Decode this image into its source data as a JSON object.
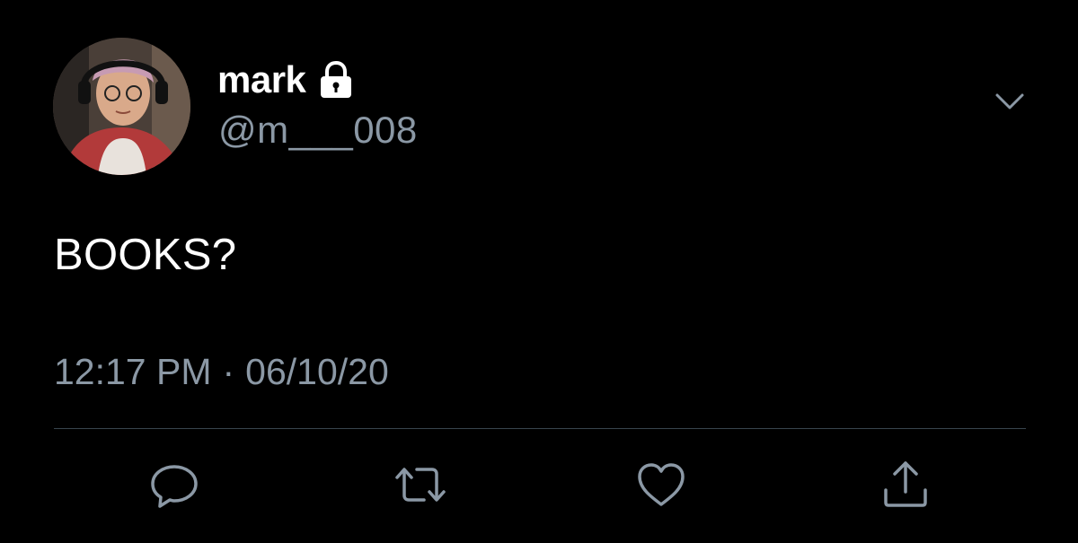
{
  "tweet": {
    "display_name": "mark",
    "handle": "@m___008",
    "text": "BOOKS?",
    "time": "12:17 PM",
    "separator": "·",
    "date": "06/10/20",
    "protected": true
  },
  "icons": {
    "lock": "lock-icon",
    "caret": "chevron-down-icon",
    "reply": "reply-icon",
    "retweet": "retweet-icon",
    "like": "heart-icon",
    "share": "share-icon"
  },
  "colors": {
    "background": "#000000",
    "primary_text": "#ffffff",
    "secondary_text": "#8b98a5",
    "divider": "#38444d"
  }
}
